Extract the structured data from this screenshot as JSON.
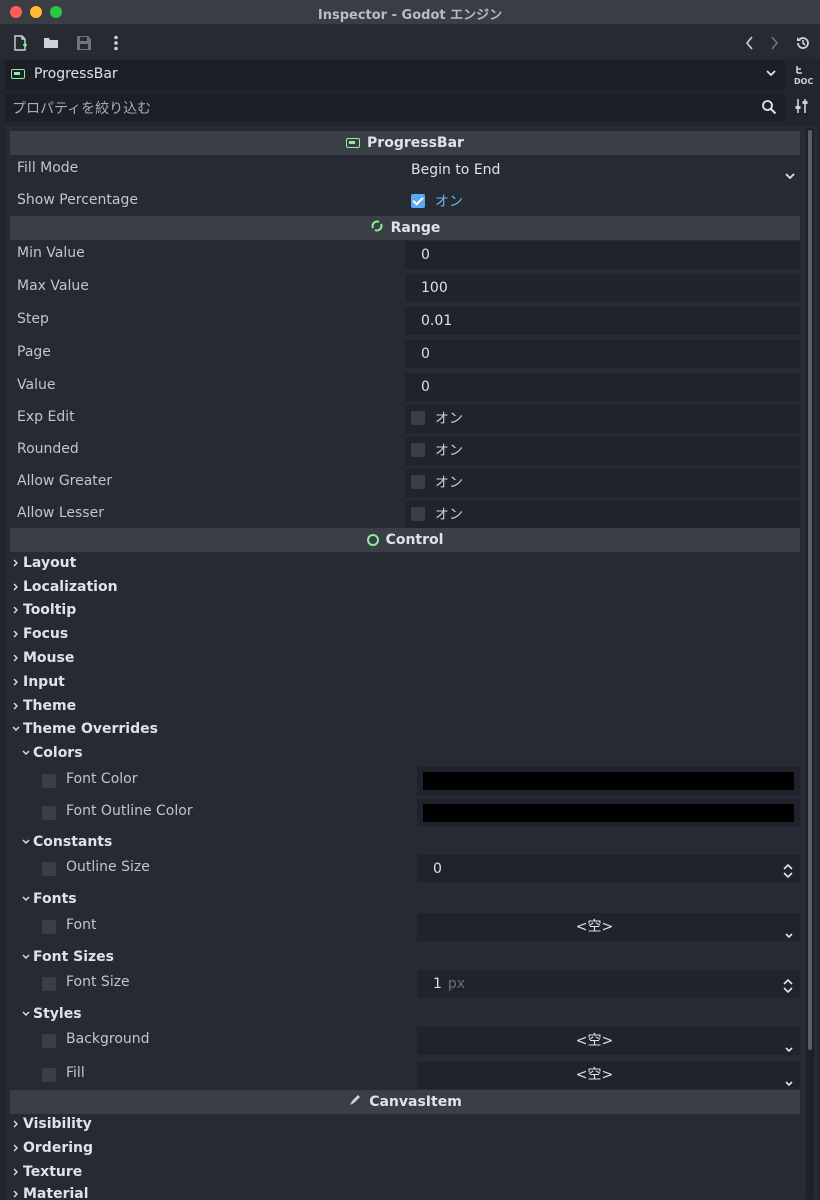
{
  "window": {
    "title": "Inspector - Godot エンジン"
  },
  "node_selector": {
    "label": "ProgressBar"
  },
  "filter": {
    "placeholder": "プロパティを絞り込む"
  },
  "sections": {
    "progressbar": "ProgressBar",
    "range": "Range",
    "control": "Control",
    "canvasitem": "CanvasItem"
  },
  "progressbar_props": {
    "fill_mode": {
      "label": "Fill Mode",
      "value": "Begin to End"
    },
    "show_percentage": {
      "label": "Show Percentage",
      "value": "オン",
      "checked": true
    }
  },
  "range_props": [
    {
      "label": "Min Value",
      "value": "0"
    },
    {
      "label": "Max Value",
      "value": "100"
    },
    {
      "label": "Step",
      "value": "0.01"
    },
    {
      "label": "Page",
      "value": "0"
    },
    {
      "label": "Value",
      "value": "0"
    }
  ],
  "range_checks": [
    {
      "label": "Exp Edit",
      "value": "オン",
      "checked": false
    },
    {
      "label": "Rounded",
      "value": "オン",
      "checked": false
    },
    {
      "label": "Allow Greater",
      "value": "オン",
      "checked": false
    },
    {
      "label": "Allow Lesser",
      "value": "オン",
      "checked": false
    }
  ],
  "control_categories": [
    "Layout",
    "Localization",
    "Tooltip",
    "Focus",
    "Mouse",
    "Input",
    "Theme",
    "Theme Overrides"
  ],
  "theme_overrides": {
    "colors": {
      "title": "Colors",
      "items": [
        {
          "label": "Font Color",
          "color": "#000000"
        },
        {
          "label": "Font Outline Color",
          "color": "#000000"
        }
      ]
    },
    "constants": {
      "title": "Constants",
      "items": [
        {
          "label": "Outline Size",
          "value": "0"
        }
      ]
    },
    "fonts": {
      "title": "Fonts",
      "items": [
        {
          "label": "Font",
          "value": "<空>"
        }
      ]
    },
    "font_sizes": {
      "title": "Font Sizes",
      "items": [
        {
          "label": "Font Size",
          "value": "1",
          "unit": "px"
        }
      ]
    },
    "styles": {
      "title": "Styles",
      "items": [
        {
          "label": "Background",
          "value": "<空>"
        },
        {
          "label": "Fill",
          "value": "<空>"
        }
      ]
    }
  },
  "canvasitem_categories": [
    "Visibility",
    "Ordering",
    "Texture",
    "Material"
  ],
  "colors": {
    "accent": "#5ca8f0",
    "section_bg": "#3a3e46",
    "panel_bg": "#262a32"
  }
}
